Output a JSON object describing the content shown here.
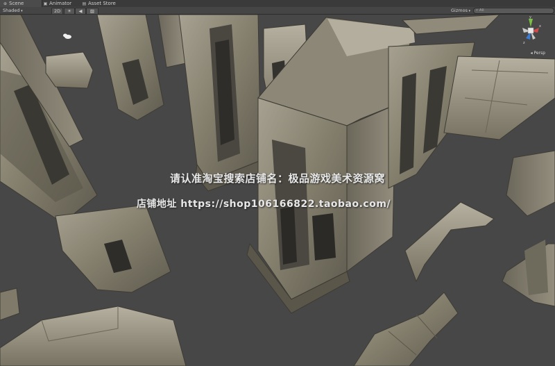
{
  "tabs": [
    {
      "label": "Scene",
      "icon": "scene-icon"
    },
    {
      "label": "Animator",
      "icon": "animator-icon"
    },
    {
      "label": "Asset Store",
      "icon": "asset-store-icon"
    }
  ],
  "toolbar": {
    "shading_mode": "Shaded",
    "mode_2d": "2D",
    "gizmos_label": "Gizmos",
    "search_placeholder": "All"
  },
  "scene": {
    "projection": "Persp",
    "gizmo_axis_y": "y",
    "gizmo_axis_x": "x",
    "gizmo_axis_z": "z"
  },
  "watermark": {
    "line1": "请认准淘宝搜索店铺名：极品游戏美术资源窝",
    "line2": "店铺地址 https://shop106166822.taobao.com/"
  },
  "colors": {
    "stone_light": "#9a9486",
    "stone_mid": "#77725f",
    "stone_dark": "#4e4b42",
    "viewport_bg": "#474747"
  }
}
